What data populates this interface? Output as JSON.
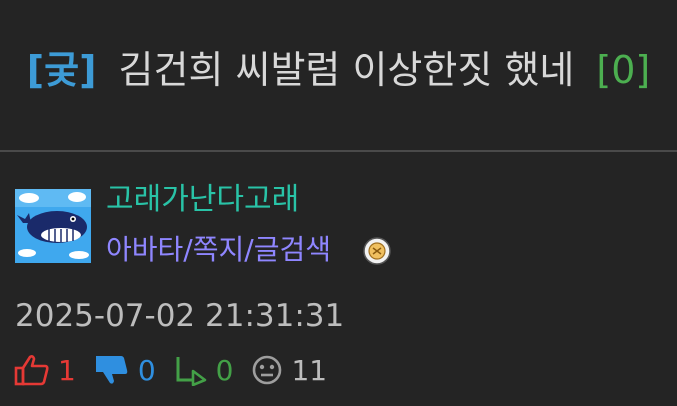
{
  "post": {
    "tag": "[궂]",
    "title": "김건희 씨발럼 이상한짓 했네",
    "comment_count": "[0]"
  },
  "author": {
    "name": "고래가난다고래",
    "link_avatar": "아바타",
    "link_message": "쪽지",
    "link_search": "글검색",
    "separator": "/"
  },
  "meta": {
    "datetime": "2025-07-02 21:31:31"
  },
  "stats": {
    "upvotes": "1",
    "downvotes": "0",
    "replies": "0",
    "views": "11"
  },
  "colors": {
    "tag": "#3d9bd6",
    "author": "#29c3a7",
    "links": "#8f86ff",
    "upvote": "#e53935",
    "downvote": "#2f8fe0",
    "reply": "#43a047"
  }
}
